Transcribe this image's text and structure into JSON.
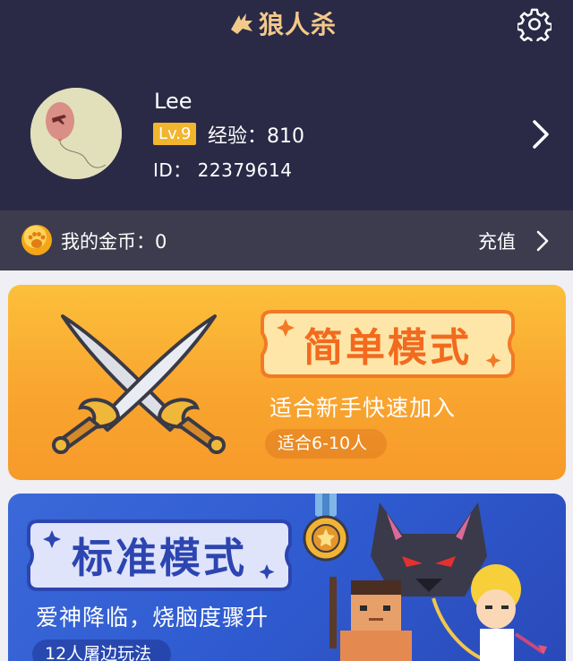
{
  "app": {
    "title": "狼人杀"
  },
  "header": {
    "settings_icon": "gear-icon"
  },
  "profile": {
    "name": "Lee",
    "level": "Lv.9",
    "exp": "经验：810",
    "id": "ID：  22379614",
    "chevron_icon": "chevron-right-icon"
  },
  "coins": {
    "label": "我的金币：0",
    "recharge": "充值"
  },
  "modes": {
    "simple": {
      "title": "简单模式",
      "desc": "适合新手快速加入",
      "players": "适合6-10人"
    },
    "standard": {
      "title": "标准模式",
      "desc": "爱神降临，烧脑度骤升",
      "players": "12人屠边玩法"
    }
  },
  "colors": {
    "header_bg": "#2a2a47",
    "coinbar_bg": "#3c3c4e",
    "level_badge": "#f1b52e",
    "simple_card": "#fbb236",
    "standard_card": "#3360d3",
    "logo": "#f3c98a"
  }
}
